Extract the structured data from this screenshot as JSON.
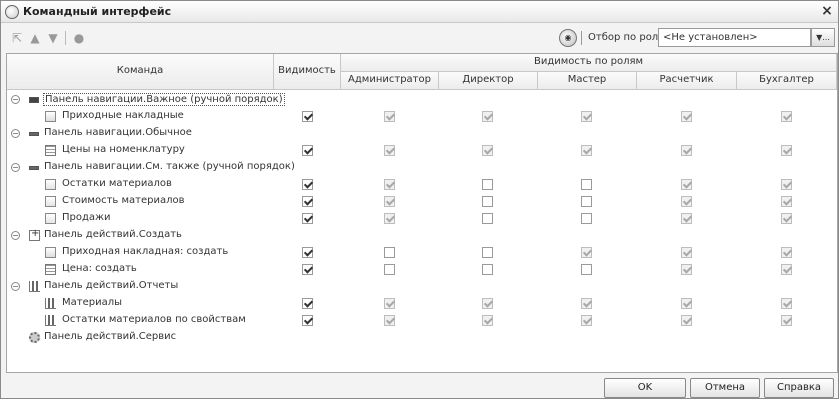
{
  "window": {
    "title": "Командный интерфейс"
  },
  "toolbar": {
    "filter_label": "Отбор по ролям:",
    "filter_value": "<Не установлен>",
    "dropdown_glyph": "▼..."
  },
  "grid": {
    "col_command": "Команда",
    "col_visibility": "Видимость",
    "col_roles_group": "Видимость по ролям",
    "roles": [
      "Администратор",
      "Директор",
      "Мастер",
      "Расчетчик",
      "Бухгалтер"
    ],
    "rows": [
      {
        "level": 0,
        "icon": "navbar-icon",
        "label": "Панель навигации.Важное (ручной порядок)",
        "group": true,
        "selected": true
      },
      {
        "level": 1,
        "icon": "document-icon",
        "label": "Приходные накладные",
        "vis": true,
        "roles": [
          true,
          true,
          true,
          true,
          true
        ]
      },
      {
        "level": 0,
        "icon": "navbar-icon",
        "label": "Панель навигации.Обычное",
        "group": true
      },
      {
        "level": 1,
        "icon": "table-icon",
        "label": "Цены на номенклатуру",
        "vis": true,
        "roles": [
          true,
          true,
          true,
          true,
          true
        ]
      },
      {
        "level": 0,
        "icon": "navbar-icon",
        "label": "Панель навигации.См. также (ручной порядок)",
        "group": true
      },
      {
        "level": 1,
        "icon": "report-icon",
        "label": "Остатки материалов",
        "vis": true,
        "roles": [
          true,
          false,
          false,
          true,
          true
        ]
      },
      {
        "level": 1,
        "icon": "report-icon",
        "label": "Стоимость материалов",
        "vis": true,
        "roles": [
          true,
          false,
          false,
          true,
          true
        ]
      },
      {
        "level": 1,
        "icon": "report-icon",
        "label": "Продажи",
        "vis": true,
        "roles": [
          true,
          false,
          false,
          true,
          true
        ]
      },
      {
        "level": 0,
        "icon": "create-icon",
        "label": "Панель действий.Создать",
        "group": true
      },
      {
        "level": 1,
        "icon": "document-icon",
        "label": "Приходная накладная: создать",
        "vis": true,
        "roles": [
          false,
          false,
          true,
          true,
          true
        ]
      },
      {
        "level": 1,
        "icon": "table-icon",
        "label": "Цена: создать",
        "vis": true,
        "roles": [
          false,
          false,
          false,
          true,
          true
        ]
      },
      {
        "level": 0,
        "icon": "chart-icon",
        "label": "Панель действий.Отчеты",
        "group": true
      },
      {
        "level": 1,
        "icon": "chart-icon",
        "label": "Материалы",
        "vis": true,
        "roles": [
          true,
          true,
          true,
          true,
          true
        ]
      },
      {
        "level": 1,
        "icon": "chart-icon",
        "label": "Остатки материалов по свойствам",
        "vis": true,
        "roles": [
          true,
          true,
          true,
          true,
          true
        ]
      },
      {
        "level": 0,
        "icon": "gear-icon",
        "label": "Панель действий.Сервис",
        "group": true,
        "no_expander": true
      }
    ]
  },
  "footer": {
    "ok": "OK",
    "cancel": "Отмена",
    "help": "Справка"
  }
}
